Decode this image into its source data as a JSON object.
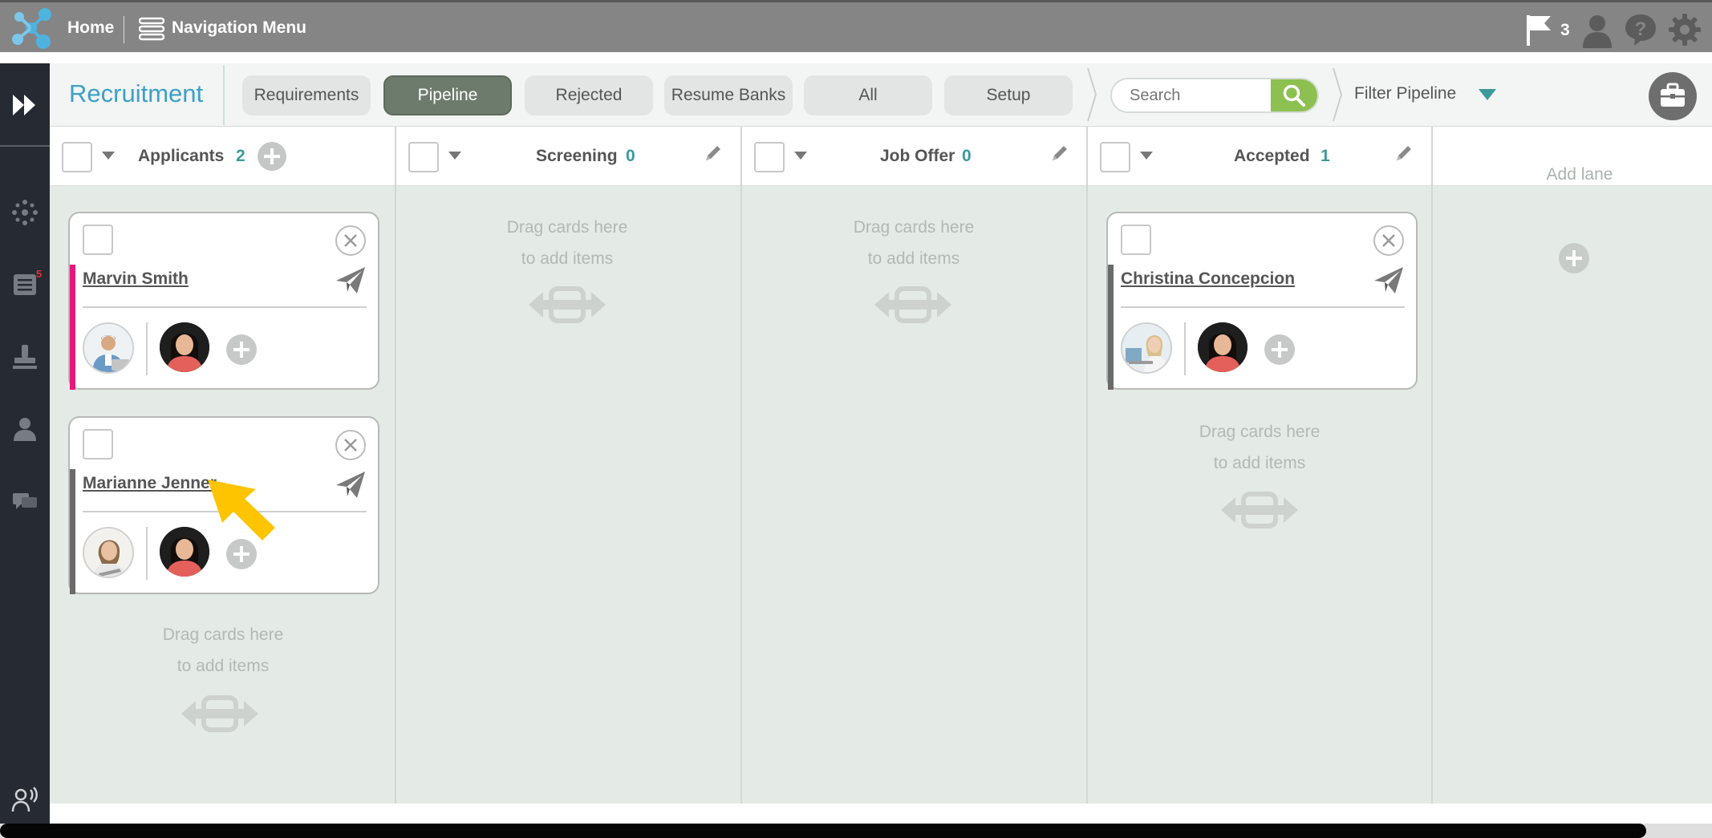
{
  "topbar": {
    "home": "Home",
    "navigation_menu": "Navigation Menu",
    "flag_count": "3"
  },
  "sidebar": {
    "badge": "5",
    "icons": [
      "expand-icon",
      "network-icon",
      "list-icon",
      "stamp-icon",
      "person-icon",
      "chat-icon",
      "broadcast-icon"
    ]
  },
  "header": {
    "title": "Recruitment",
    "tabs": [
      {
        "label": "Requirements"
      },
      {
        "label": "Pipeline",
        "active": true
      },
      {
        "label": "Rejected"
      },
      {
        "label": "Resume Banks"
      },
      {
        "label": "All"
      },
      {
        "label": "Setup"
      }
    ],
    "search_placeholder": "Search",
    "filter": "Filter Pipeline"
  },
  "lanes": [
    {
      "title": "Applicants",
      "count": "2"
    },
    {
      "title": "Screening",
      "count": "0"
    },
    {
      "title": "Job Offer",
      "count": "0"
    },
    {
      "title": "Accepted",
      "count": "1"
    }
  ],
  "drag_hint": {
    "line1": "Drag cards here",
    "line2": "to add items"
  },
  "add_lane": "Add lane",
  "cards": [
    {
      "name": "Marvin Smith",
      "lane": "Applicants",
      "accent": "#e6197a"
    },
    {
      "name": "Marianne Jenner",
      "lane": "Applicants",
      "accent": "#6a6a6a"
    },
    {
      "name": "Christina Concepcion",
      "lane": "Accepted",
      "accent": "#6a6a6a"
    }
  ],
  "colors": {
    "topbar": "#858585",
    "sidebar": "#262a33",
    "accent_blue": "#3ba0c8",
    "count_teal": "#3a9a9c",
    "search_button": "#8cc051",
    "active_tab": "#6d7b6c",
    "pointer": "#ffc400"
  }
}
